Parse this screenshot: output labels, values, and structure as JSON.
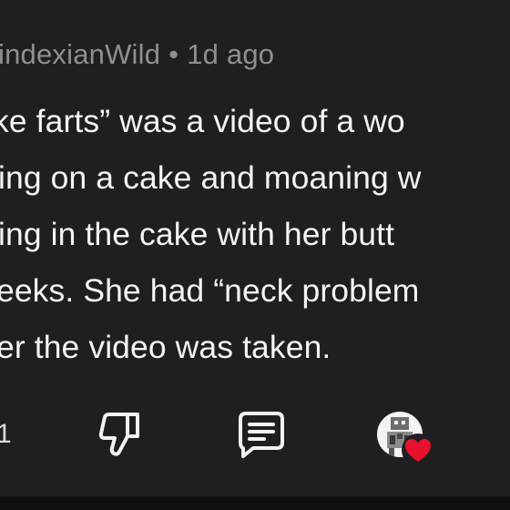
{
  "comment": {
    "username": "indexianWild",
    "separator": "•",
    "timestamp": "1d ago",
    "lines": [
      "ke farts” was a video of a wo",
      "ing on a cake and moaning w",
      "ing in the cake with her butt",
      "eeks. She had “neck problem",
      "er the video was taken."
    ]
  },
  "actions": {
    "vote_count": "1",
    "downvote_icon": "thumbs-down-icon",
    "reply_icon": "comment-bubble-icon",
    "award_icon": "avatar-with-heart-icon"
  },
  "colors": {
    "background": "#1f1f21",
    "text": "#f4f4f4",
    "meta": "#8e8e93",
    "heart": "#e8112d"
  }
}
